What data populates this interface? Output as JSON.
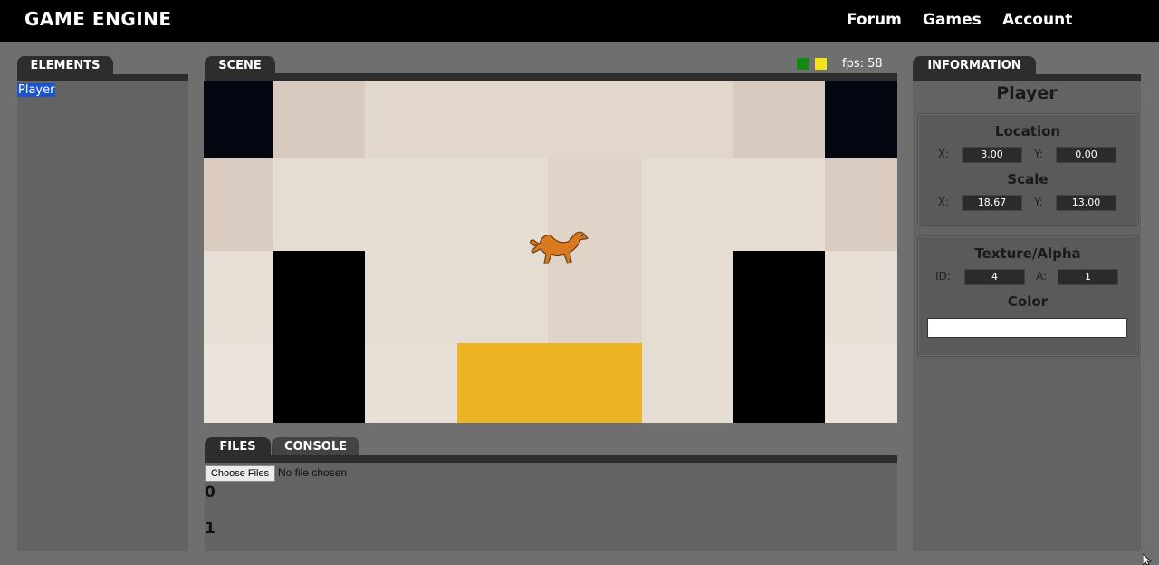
{
  "app": {
    "title": "GAME ENGINE",
    "nav": {
      "forum": "Forum",
      "games": "Games",
      "account": "Account"
    }
  },
  "elements_panel": {
    "tab_label": "ELEMENTS",
    "items": [
      "Player"
    ]
  },
  "scene_panel": {
    "tab_label": "SCENE",
    "fps_text": "fps: 58",
    "status_colors": [
      "#138a13",
      "#f3e21e"
    ]
  },
  "bottom_panel": {
    "tabs": [
      "FILES",
      "CONSOLE"
    ],
    "choose_label": "Choose Files",
    "no_file_text": "No file chosen",
    "entries": [
      "0",
      "1"
    ]
  },
  "info_panel": {
    "tab_label": "INFORMATION",
    "object_name": "Player",
    "location": {
      "title": "Location",
      "x_label": "X:",
      "x": "3.00",
      "y_label": "Y:",
      "y": "0.00"
    },
    "scale": {
      "title": "Scale",
      "x_label": "X:",
      "x": "18.67",
      "y_label": "Y:",
      "y": "13.00"
    },
    "texture": {
      "title": "Texture/Alpha",
      "id_label": "ID:",
      "id": "4",
      "a_label": "A:",
      "a": "1"
    },
    "color": {
      "title": "Color",
      "value": "#ffffff"
    }
  },
  "colors": {
    "nav_bg": "#000000",
    "panel_bg": "#636363",
    "tab_bg": "#2d2d2d",
    "selection": "#1a54c8",
    "floor_yellow": "#ecb424"
  }
}
